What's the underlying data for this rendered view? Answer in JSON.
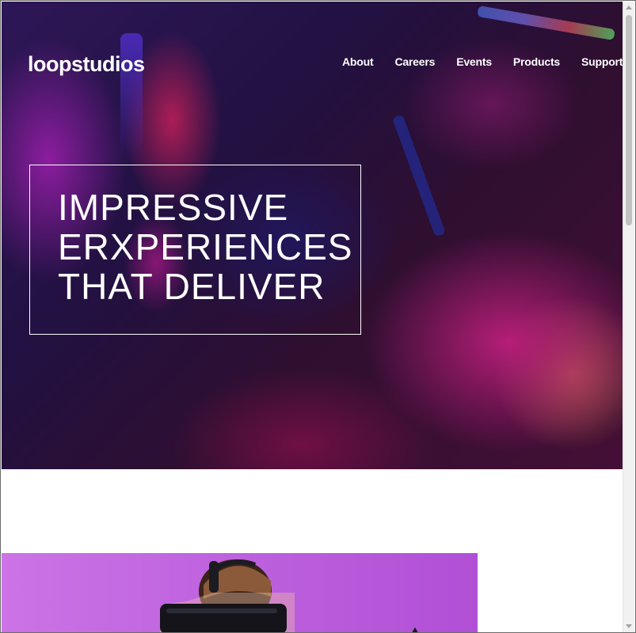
{
  "header": {
    "logo": "loopstudios",
    "nav": [
      "About",
      "Careers",
      "Events",
      "Products",
      "Support"
    ]
  },
  "hero": {
    "title_lines": [
      "IMPRESSIVE",
      "ERXPERIENCES",
      "THAT DELIVER"
    ]
  },
  "icons": {
    "scroll_up": "scroll-up-arrow-icon",
    "scroll_down": "scroll-down-arrow-icon",
    "cursor": "mouse-cursor-icon"
  },
  "colors": {
    "text_on_hero": "#ffffff",
    "page_background": "#ffffff",
    "vr_image_tint": "#c065df"
  }
}
